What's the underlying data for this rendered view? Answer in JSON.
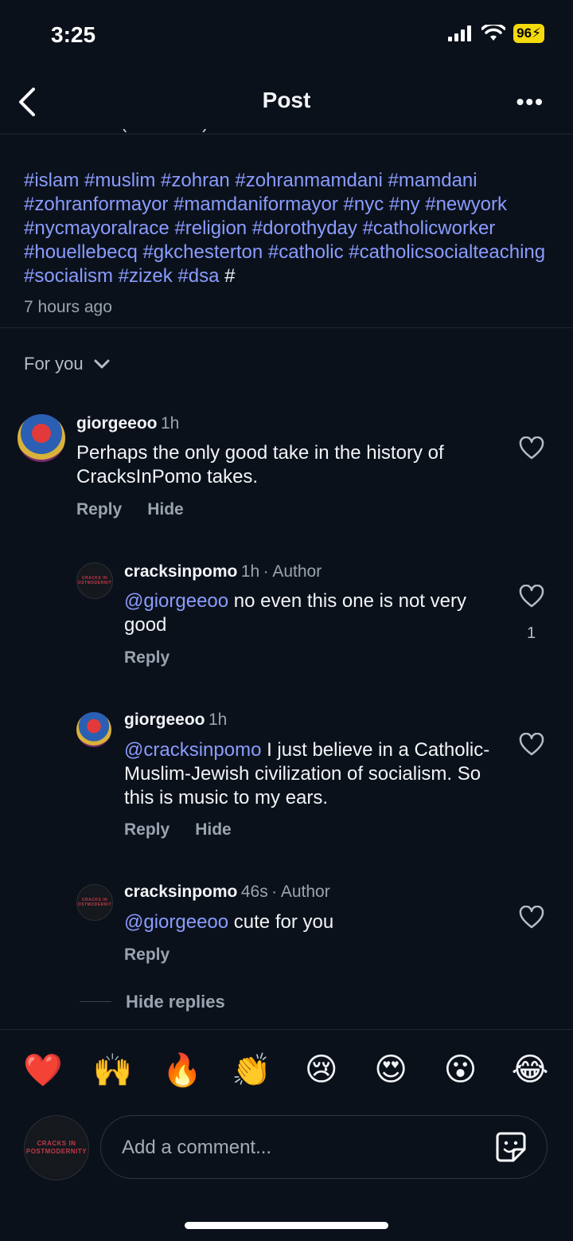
{
  "status_bar": {
    "time": "3:25",
    "battery": "96"
  },
  "header": {
    "title": "Post"
  },
  "post": {
    "cut_line": "DM for link (insnalian)",
    "hashtags": "#islam #muslim #zohran #zohranmamdani #mamdani #zohranformayor #mamdaniformayor #nyc #ny #newyork #nycmayoralrace #religion #dorothyday #catholicworker #houellebecq #gkchesterton #catholic #catholicsocialteaching #socialism #zizek #dsa",
    "hashtags_trail": "#",
    "timestamp": "7 hours ago"
  },
  "sort": {
    "label": "For you"
  },
  "comments": [
    {
      "username": "giorgeeoo",
      "time": "1h",
      "author_tag": "",
      "mention": "",
      "text": "Perhaps the only good take in the history of CracksInPomo takes.",
      "reply": "Reply",
      "hide": "Hide",
      "likes": ""
    },
    {
      "username": "cracksinpomo",
      "time": "1h",
      "author_tag": "· Author",
      "mention": "@giorgeeoo",
      "text": " no even this one is not very good",
      "reply": "Reply",
      "hide": "",
      "likes": "1"
    },
    {
      "username": "giorgeeoo",
      "time": "1h",
      "author_tag": "",
      "mention": "@cracksinpomo",
      "text": " I just believe in a Catholic-Muslim-Jewish civilization of socialism. So this is music to my ears.",
      "reply": "Reply",
      "hide": "Hide",
      "likes": ""
    },
    {
      "username": "cracksinpomo",
      "time": "46s",
      "author_tag": "· Author",
      "mention": "@giorgeeoo",
      "text": " cute for you",
      "reply": "Reply",
      "hide": "",
      "likes": ""
    }
  ],
  "hide_replies": "Hide replies",
  "avatar_logo_text": "CRACKS IN POSTMODERNITY",
  "reactions": [
    "❤️",
    "🙌",
    "🔥",
    "👏",
    "😢",
    "😍",
    "😮",
    "😂"
  ],
  "composer": {
    "placeholder": "Add a comment..."
  },
  "colors": {
    "background": "#0b111b",
    "link": "#8a9cff",
    "battery": "#f4d90b"
  }
}
